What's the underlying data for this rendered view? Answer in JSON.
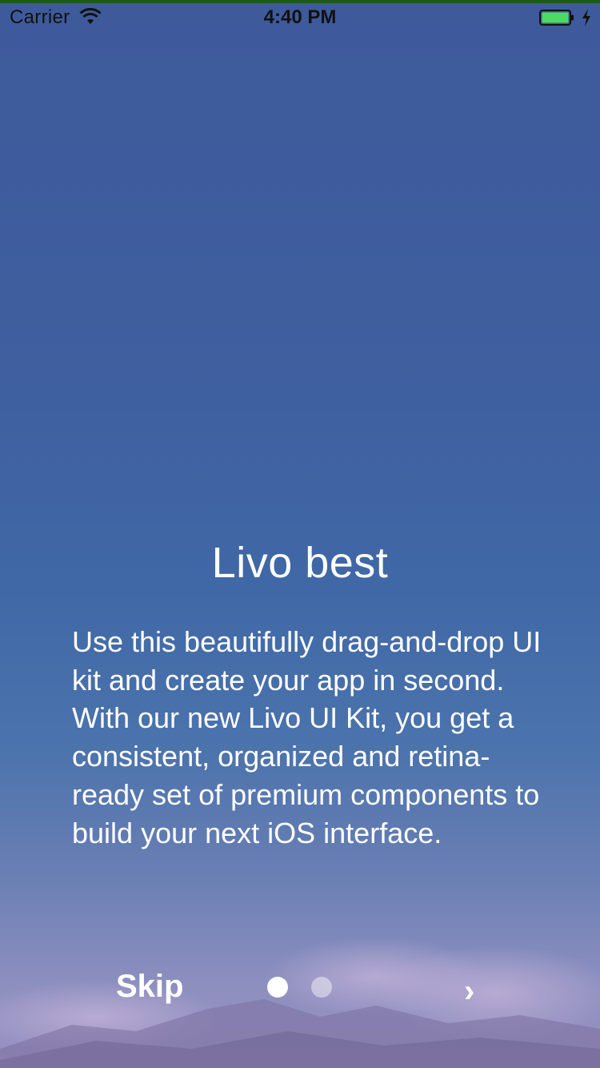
{
  "status_bar": {
    "carrier": "Carrier",
    "time": "4:40 PM",
    "wifi_icon": "wifi-icon",
    "battery_icon": "battery-charging-icon",
    "battery_color": "#4cd964"
  },
  "onboarding": {
    "title": "Livo best",
    "description": "Use this beautifully drag-and-drop UI kit and create your app in second. With our new Livo UI Kit, you get a consistent, organized and retina-ready set of premium components to build your next iOS interface.",
    "page_indicator": {
      "current_page": 1,
      "total_pages": 2
    },
    "skip_label": "Skip",
    "next_label": "›"
  },
  "colors": {
    "background_top": "#3e5a9b",
    "background_bottom": "#9a92c2",
    "text": "#ffffff"
  }
}
